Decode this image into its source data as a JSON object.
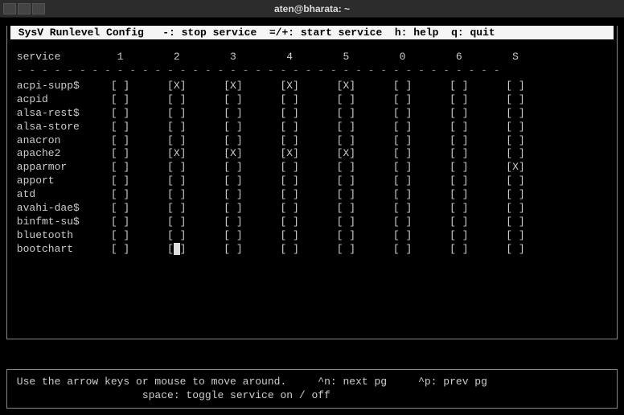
{
  "window": {
    "title": "aten@bharata: ~"
  },
  "app": {
    "header": " SysV Runlevel Config   -: stop service  =/+: start service  h: help  q: quit "
  },
  "columns": {
    "label": "service",
    "levels": [
      "1",
      "2",
      "3",
      "4",
      "5",
      "0",
      "6",
      "S"
    ]
  },
  "separator_line": " - - - - - - - - - - - - - - - - - - - - - - - - - - - - - - - - - - - - - - -",
  "services": [
    {
      "name": "acpi-supp$",
      "states": [
        " ",
        "X",
        "X",
        "X",
        "X",
        " ",
        " ",
        " "
      ]
    },
    {
      "name": "acpid",
      "states": [
        " ",
        " ",
        " ",
        " ",
        " ",
        " ",
        " ",
        " "
      ]
    },
    {
      "name": "alsa-rest$",
      "states": [
        " ",
        " ",
        " ",
        " ",
        " ",
        " ",
        " ",
        " "
      ]
    },
    {
      "name": "alsa-store",
      "states": [
        " ",
        " ",
        " ",
        " ",
        " ",
        " ",
        " ",
        " "
      ]
    },
    {
      "name": "anacron",
      "states": [
        " ",
        " ",
        " ",
        " ",
        " ",
        " ",
        " ",
        " "
      ]
    },
    {
      "name": "apache2",
      "states": [
        " ",
        "X",
        "X",
        "X",
        "X",
        " ",
        " ",
        " "
      ]
    },
    {
      "name": "apparmor",
      "states": [
        " ",
        " ",
        " ",
        " ",
        " ",
        " ",
        " ",
        "X"
      ]
    },
    {
      "name": "apport",
      "states": [
        " ",
        " ",
        " ",
        " ",
        " ",
        " ",
        " ",
        " "
      ]
    },
    {
      "name": "atd",
      "states": [
        " ",
        " ",
        " ",
        " ",
        " ",
        " ",
        " ",
        " "
      ]
    },
    {
      "name": "avahi-dae$",
      "states": [
        " ",
        " ",
        " ",
        " ",
        " ",
        " ",
        " ",
        " "
      ]
    },
    {
      "name": "binfmt-su$",
      "states": [
        " ",
        " ",
        " ",
        " ",
        " ",
        " ",
        " ",
        " "
      ]
    },
    {
      "name": "bluetooth",
      "states": [
        " ",
        " ",
        " ",
        " ",
        " ",
        " ",
        " ",
        " "
      ]
    },
    {
      "name": "bootchart",
      "states": [
        " ",
        " ",
        " ",
        " ",
        " ",
        " ",
        " ",
        " "
      ]
    }
  ],
  "cursor": {
    "row": 12,
    "col": 1
  },
  "footer": {
    "line1": " Use the arrow keys or mouse to move around.     ^n: next pg     ^p: prev pg",
    "line2": "                     space: toggle service on / off"
  }
}
